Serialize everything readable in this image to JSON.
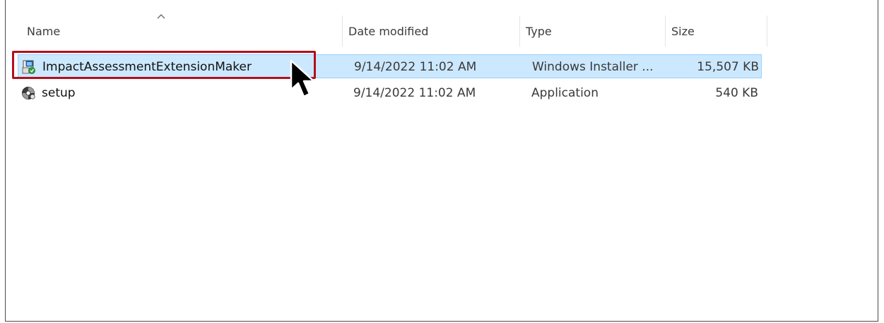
{
  "columns": {
    "name": "Name",
    "date_modified": "Date modified",
    "type": "Type",
    "size": "Size"
  },
  "sort": {
    "column": "name",
    "direction": "ascending",
    "icon": "chevron-up-icon"
  },
  "files": [
    {
      "name": "ImpactAssessmentExtensionMaker",
      "date_modified": "9/14/2022 11:02 AM",
      "type": "Windows Installer ...",
      "size": "15,507 KB",
      "icon": "windows-installer-package-icon",
      "selected": true
    },
    {
      "name": "setup",
      "date_modified": "9/14/2022 11:02 AM",
      "type": "Application",
      "size": "540 KB",
      "icon": "setup-application-icon",
      "selected": false
    }
  ],
  "colors": {
    "selection_background": "#cce8ff",
    "selection_border": "#99d1ff",
    "highlight_annotation": "#b0101c"
  }
}
